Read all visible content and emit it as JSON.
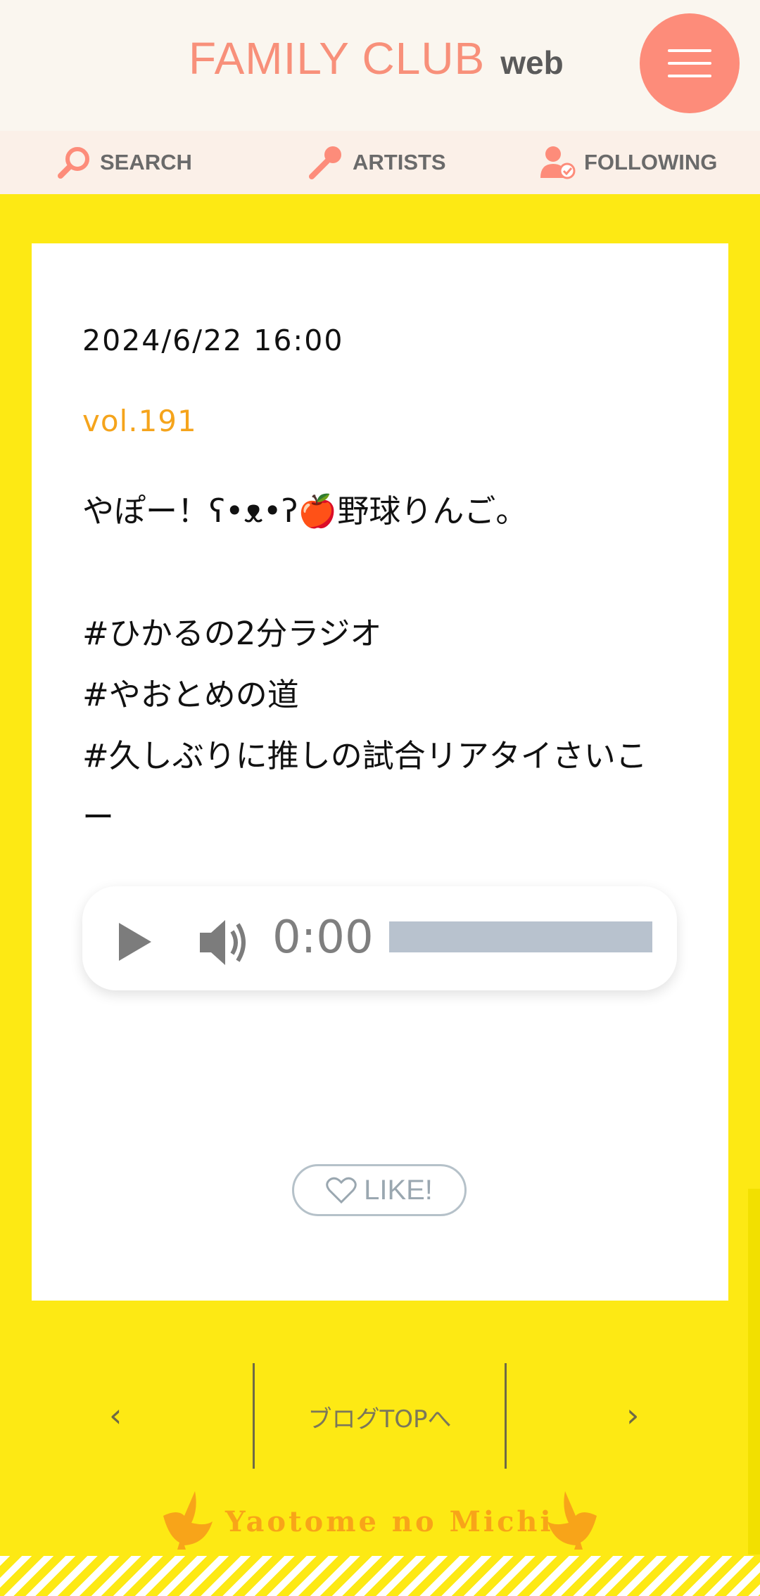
{
  "header": {
    "logo_main": "FAMILY CLUB",
    "logo_sub": "web",
    "menu_icon": "hamburger-menu-icon"
  },
  "nav": {
    "items": [
      {
        "label": "SEARCH",
        "icon": "search-icon"
      },
      {
        "label": "ARTISTS",
        "icon": "microphone-icon"
      },
      {
        "label": "FOLLOWING",
        "icon": "user-check-icon"
      }
    ]
  },
  "post": {
    "date": "2024/6/22 16:00",
    "volume": "vol.191",
    "lines": [
      "やぽー！ʕ•ᴥ•ʔ🍎野球りんご。",
      "",
      "#ひかるの2分ラジオ",
      "#やおとめの道",
      "#久しぶりに推しの試合リアタイさいこ",
      "ー"
    ]
  },
  "audio": {
    "time": "0:00",
    "progress": 0
  },
  "like": {
    "label": "LIKE!"
  },
  "pager": {
    "prev": "‹",
    "top_label": "ブログTOPへ",
    "next": "›"
  },
  "footer": {
    "title": "Yaotome no Michi"
  },
  "colors": {
    "accent": "#fd8c7a",
    "background": "#fde914",
    "volume_orange": "#f5a41c"
  }
}
